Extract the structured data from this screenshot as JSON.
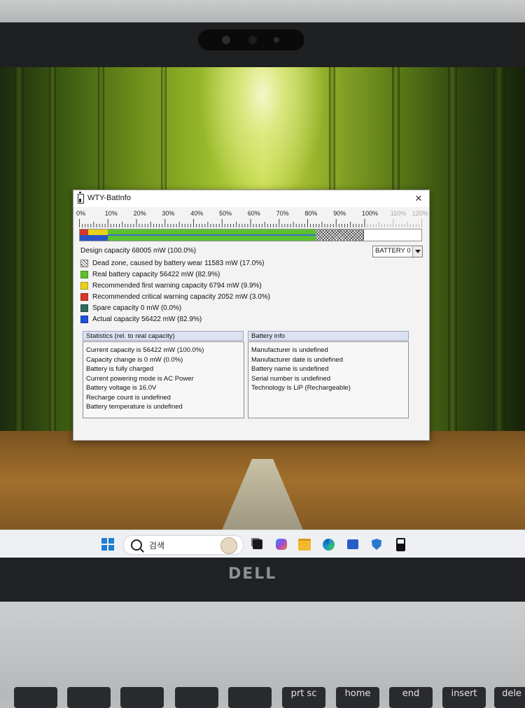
{
  "window": {
    "title": "WTY-BatInfo",
    "close_glyph": "✕"
  },
  "scale": {
    "labels": [
      "0%",
      "10%",
      "20%",
      "30%",
      "40%",
      "50%",
      "60%",
      "70%",
      "80%",
      "90%",
      "100%",
      "110%",
      "120%"
    ],
    "dimmed_from_index": 11
  },
  "capacity_bar": {
    "segments_percent_of_design": {
      "critical": 3.0,
      "first_warning": 9.9,
      "real": 82.9,
      "dead_zone": 17.0
    }
  },
  "design_capacity": "Design capacity 68005 mW (100.0%)",
  "battery_select": {
    "value": "BATTERY 0"
  },
  "legend": [
    {
      "label": "Dead zone, caused by battery wear 11583 mW (17.0%)",
      "color": "hatch"
    },
    {
      "label": "Real battery capacity 56422 mW (82.9%)",
      "color": "#5cc12e"
    },
    {
      "label": "Recommended first warning capacity 6794 mW (9.9%)",
      "color": "#e8d21a"
    },
    {
      "label": "Recommended critical warning capacity 2052 mW (3.0%)",
      "color": "#d8362a"
    },
    {
      "label": "Spare capacity  0 mW (0.0%)",
      "color": "#2f6a63"
    },
    {
      "label": "Actual capacity 56422 mW (82.9%)",
      "color": "#1f4fd8"
    }
  ],
  "statistics": {
    "header": "Statistics (rel. to real capacity)",
    "lines": [
      "Current capacity is 56422 mW (100.0%)",
      "Capacity change is 0 mW (0.0%)",
      "Battery is fully charged",
      "Current powering mode is AC Power",
      "Battery voltage is 16.0V",
      "Recharge count is undefined",
      "Battery temperature is undefined"
    ]
  },
  "battery_info": {
    "header": "Battery info",
    "lines": [
      "Manufacturer is undefined",
      "Manufacturer date is undefined",
      "Battery name is undefined",
      "Serial number is undefined",
      "Technology is  LiP (Rechargeable)"
    ]
  },
  "taskbar": {
    "search_text": "검색",
    "icons": [
      "windows-start-icon",
      "search-icon",
      "task-view-icon",
      "copilot-icon",
      "file-explorer-icon",
      "edge-icon",
      "store-icon",
      "defender-icon",
      "battery-app-icon"
    ]
  },
  "hardware": {
    "brand": "DELL",
    "keys": [
      "prt sc",
      "home",
      "end",
      "insert",
      "dele"
    ]
  }
}
